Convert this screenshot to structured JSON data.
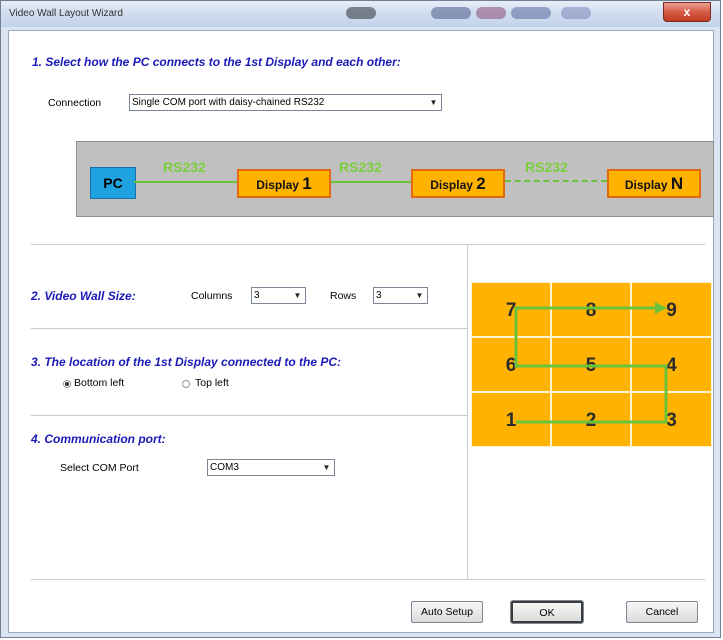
{
  "window": {
    "title": "Video Wall Layout Wizard",
    "close_label": "x"
  },
  "section1": {
    "title": "1. Select how the PC connects to the 1st Display and each other:",
    "connection_label": "Connection",
    "connection_value": "Single COM port with daisy-chained RS232"
  },
  "diagram": {
    "pc": "PC",
    "link1": "RS232",
    "link2": "RS232",
    "link3": "RS232",
    "display_word": "Display",
    "d1": "1",
    "d2": "2",
    "dn": "N"
  },
  "section2": {
    "title": "2. Video Wall Size:",
    "columns_label": "Columns",
    "columns_value": "3",
    "rows_label": "Rows",
    "rows_value": "3"
  },
  "section3": {
    "title": "3. The location of the 1st Display connected to the PC:",
    "options": [
      {
        "label": "Bottom left",
        "selected": true
      },
      {
        "label": "Top left",
        "selected": false
      }
    ]
  },
  "section4": {
    "title": "4. Communication port:",
    "port_label": "Select COM Port",
    "port_value": "COM3"
  },
  "grid": {
    "colors": {
      "cell": "#ffb300",
      "path": "#68c23a"
    },
    "rows": [
      [
        "7",
        "8",
        "9"
      ],
      [
        "6",
        "5",
        "4"
      ],
      [
        "1",
        "2",
        "3"
      ]
    ]
  },
  "buttons": {
    "auto_setup": "Auto Setup",
    "ok": "OK",
    "cancel": "Cancel"
  }
}
